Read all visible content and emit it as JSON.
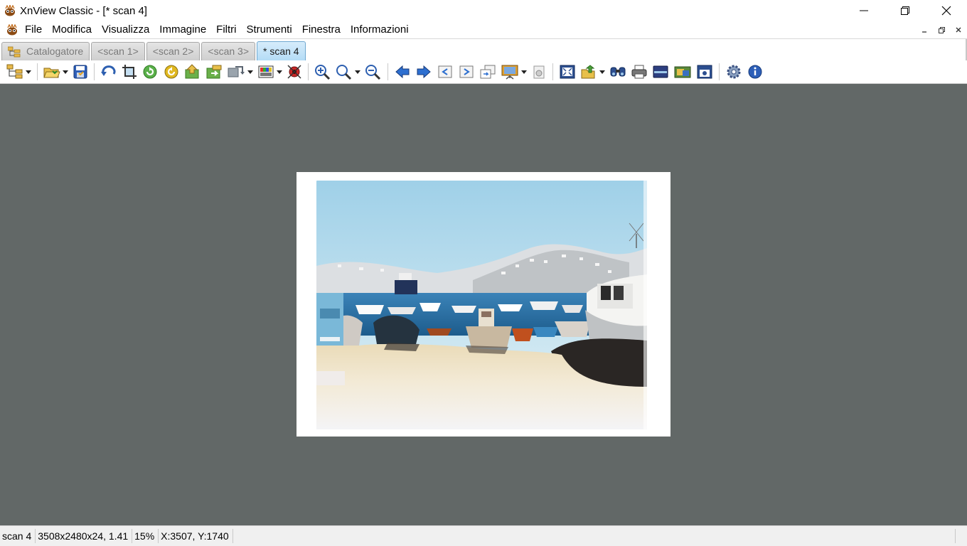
{
  "window": {
    "title": "XnView Classic - [* scan 4]"
  },
  "menu": {
    "items": [
      "File",
      "Modifica",
      "Visualizza",
      "Immagine",
      "Filtri",
      "Strumenti",
      "Finestra",
      "Informazioni"
    ]
  },
  "tabs": [
    {
      "label": "Catalogatore",
      "active": false,
      "icon": "browser-icon"
    },
    {
      "label": "<scan 1>",
      "active": false
    },
    {
      "label": "<scan 2>",
      "active": false
    },
    {
      "label": "<scan 3>",
      "active": false
    },
    {
      "label": "* scan 4",
      "active": true
    }
  ],
  "toolbar": {
    "icons": [
      "tree-view-icon",
      "open-folder-icon",
      "save-icon",
      "undo-icon",
      "crop-icon",
      "rotate-left-icon",
      "rotate-right-icon",
      "previous-image-icon",
      "next-file-icon",
      "convert-icon",
      "adjust-colors-icon",
      "red-eye-icon",
      "zoom-in-icon",
      "zoom-icon",
      "zoom-out-icon",
      "arrow-left-icon",
      "arrow-right-icon",
      "first-page-icon",
      "last-page-icon",
      "multi-page-icon",
      "slideshow-icon",
      "properties-icon",
      "fit-screen-icon",
      "export-icon",
      "search-icon",
      "print-icon",
      "scanner-icon",
      "capture-icon",
      "screenshot-icon",
      "settings-icon",
      "info-icon"
    ]
  },
  "status": {
    "name": "scan 4",
    "dims": "3508x2480x24, 1.41",
    "zoom": "15%",
    "coords": "X:3507, Y:1740"
  },
  "colors": {
    "viewer_bg": "#626867",
    "active_tab": "#b4dcf6",
    "accent": "#1e7fd6"
  }
}
